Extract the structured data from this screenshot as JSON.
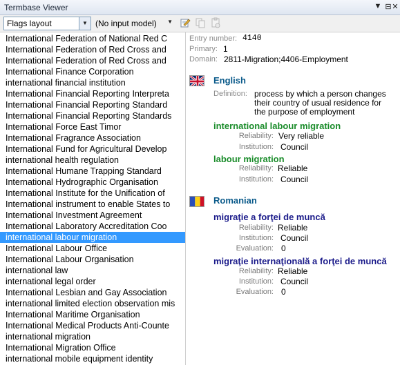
{
  "window": {
    "title": "Termbase Viewer"
  },
  "toolbar": {
    "layout_value": "Flags layout",
    "input_model_value": "(No input model)"
  },
  "terms": [
    "International Federation of National Red C",
    "International Federation of Red Cross and",
    "International Federation of Red Cross and",
    "International Finance Corporation",
    "international financial institution",
    "International Financial Reporting Interpreta",
    "International Financial Reporting Standard",
    "International Financial Reporting Standards",
    "International Force East Timor",
    "International Fragrance Association",
    "International Fund for Agricultural Develop",
    "international health regulation",
    "International Humane Trapping Standard",
    "International Hydrographic Organisation",
    "International Institute for the Unification of",
    "International instrument to enable States to",
    "International Investment Agreement",
    "International Laboratory Accreditation Coo",
    "international labour migration",
    "International Labour Office",
    "International Labour Organisation",
    "international law",
    "international legal order",
    "International Lesbian and Gay Association",
    "international limited election observation mis",
    "International Maritime Organisation",
    "International Medical Products Anti-Counte",
    "international migration",
    "International Migration Office",
    "international mobile equipment identity"
  ],
  "selected_index": 18,
  "entry": {
    "number_label": "Entry number:",
    "number": "4140",
    "primary_label": "Primary:",
    "primary": "1",
    "domain_label": "Domain:",
    "domain": "2811-Migration;4406-Employment"
  },
  "english": {
    "language": "English",
    "definition_label": "Definition:",
    "definition_lines": [
      "process by which a person changes",
      "their country of usual residence for",
      "the purpose of employment"
    ],
    "terms": [
      {
        "term": "international labour migration",
        "reliability_label": "Reliability:",
        "reliability": "Very reliable",
        "institution_label": "Institution:",
        "institution": "Council"
      },
      {
        "term": "labour migration",
        "reliability_label": "Reliability:",
        "reliability": "Reliable",
        "institution_label": "Institution:",
        "institution": "Council"
      }
    ]
  },
  "romanian": {
    "language": "Romanian",
    "terms": [
      {
        "term": "migraţie a forţei de muncă",
        "reliability_label": "Reliability:",
        "reliability": "Reliable",
        "institution_label": "Institution:",
        "institution": "Council",
        "evaluation_label": "Evaluation:",
        "evaluation": "0"
      },
      {
        "term": "migraţie internaţională a forţei de muncă",
        "reliability_label": "Reliability:",
        "reliability": "Reliable",
        "institution_label": "Institution:",
        "institution": "Council",
        "evaluation_label": "Evaluation:",
        "evaluation": "0"
      }
    ]
  },
  "icons": {
    "pin": "pin-icon",
    "close": "close-icon",
    "dropdown": "chevron-down-icon",
    "edit": "edit-icon",
    "copy": "copy-icon",
    "paste": "paste-icon",
    "uk_flag": "uk-flag-icon",
    "ro_flag": "romania-flag-icon"
  }
}
